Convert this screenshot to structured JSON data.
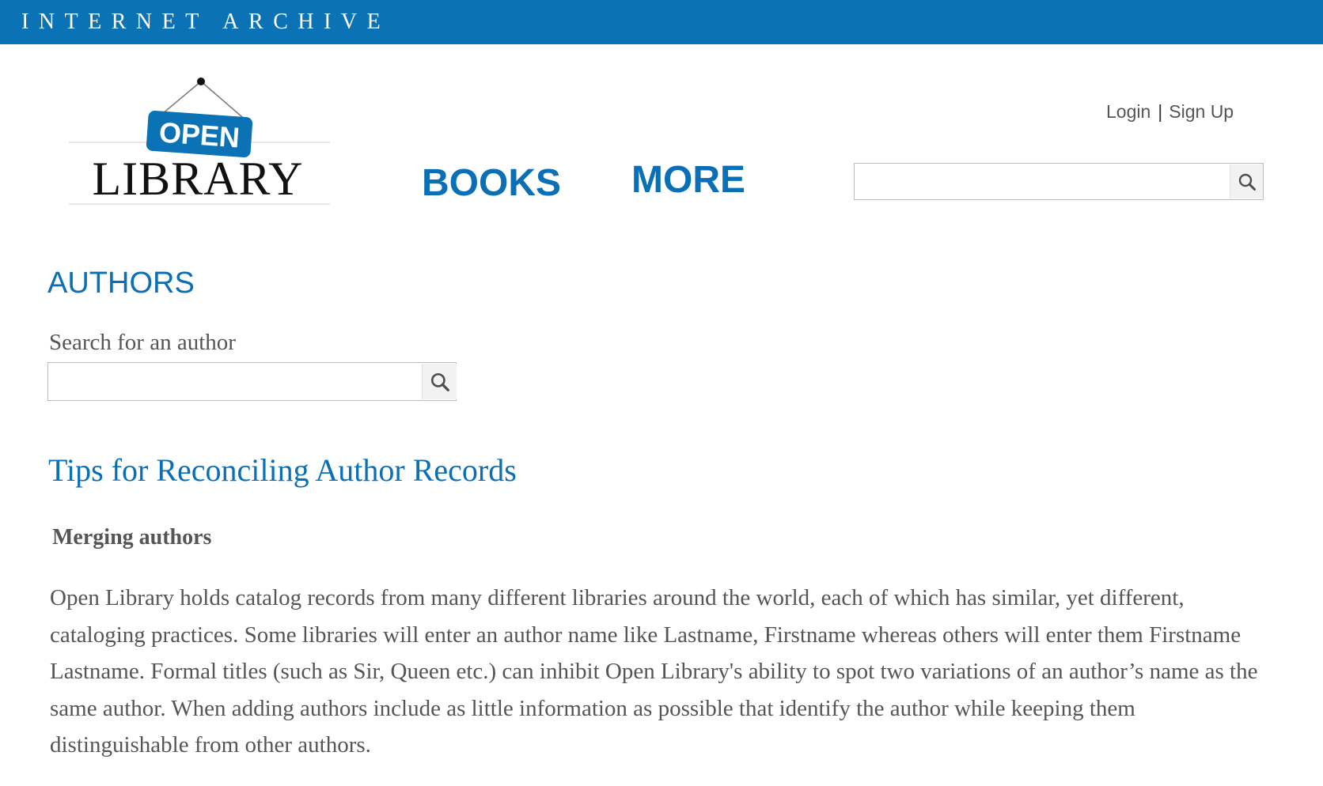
{
  "topbar": {
    "title": "INTERNET ARCHIVE",
    "background_color": "#0a72b5"
  },
  "logo": {
    "sign_text": "OPEN",
    "wordmark": "LIBRARY",
    "sign_color": "#0a72b5"
  },
  "nav": {
    "books_label": "BOOKS",
    "more_label": "MORE"
  },
  "auth": {
    "login_label": "Login",
    "separator": "|",
    "signup_label": "Sign Up"
  },
  "header_search": {
    "placeholder": "",
    "value": "",
    "icon": "search-icon"
  },
  "page": {
    "title": "AUTHORS",
    "search_label": "Search for an author",
    "author_search": {
      "placeholder": "",
      "value": "",
      "icon": "search-icon"
    }
  },
  "tips": {
    "heading": "Tips for Reconciling Author Records",
    "subheading": "Merging authors",
    "paragraph": "Open Library holds catalog records from many different libraries around the world, each of which has similar, yet different, cataloging practices. Some libraries will enter an author name like Lastname, Firstname whereas others will enter them Firstname Lastname. Formal titles (such as Sir, Queen etc.) can inhibit Open Library's ability to spot two variations of an author’s name as the same author. When adding authors include as little information as possible that identify the author while keeping them distinguishable from other authors."
  },
  "colors": {
    "link_blue": "#0b6fb5",
    "body_text": "#555555"
  }
}
